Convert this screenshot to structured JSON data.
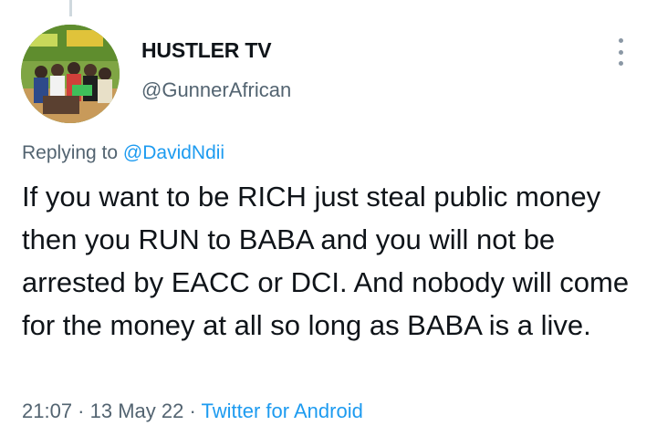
{
  "tweet": {
    "display_name": "HUSTLER TV",
    "handle": "@GunnerAfrican",
    "replying_prefix": "Replying to ",
    "replying_to": "@DavidNdii",
    "text": "If you want to be RICH just steal public money then you RUN to BABA and you will not be arrested by EACC or DCI. And nobody will come for the money at all so long as BABA is a live.",
    "time": "21:07",
    "separator": " · ",
    "date": "13 May 22",
    "source": "Twitter for Android",
    "more_icon": "more-vertical-icon",
    "colors": {
      "link": "#1d9bf0",
      "secondary_text": "#536471",
      "primary_text": "#0f1419",
      "thread_line": "#cfd9de"
    }
  }
}
